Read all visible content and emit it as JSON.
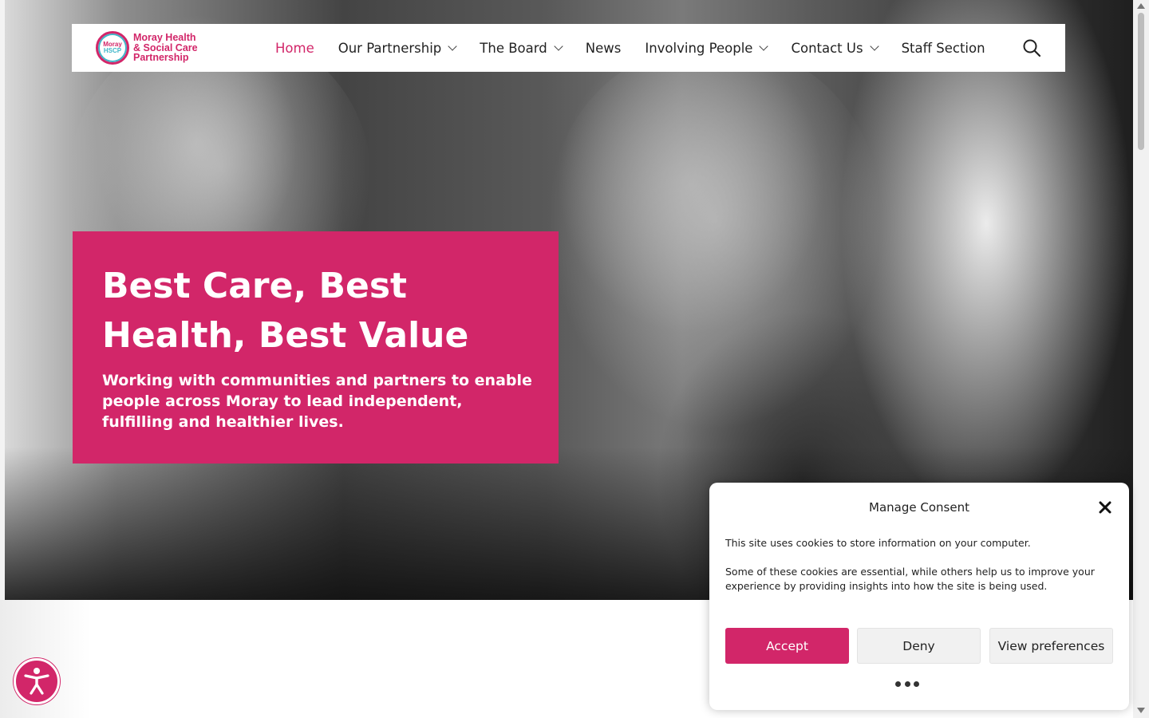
{
  "brand": {
    "logo_circle_line1": "Moray",
    "logo_circle_line2": "HSCP",
    "logo_text": "Moray Health\n& Social Care\nPartnership",
    "accent_color": "#d22669",
    "secondary_color": "#3fb6c9"
  },
  "nav": {
    "items": [
      {
        "label": "Home",
        "active": true,
        "has_dropdown": false
      },
      {
        "label": "Our Partnership",
        "active": false,
        "has_dropdown": true
      },
      {
        "label": "The Board",
        "active": false,
        "has_dropdown": true
      },
      {
        "label": "News",
        "active": false,
        "has_dropdown": false
      },
      {
        "label": "Involving People",
        "active": false,
        "has_dropdown": true
      },
      {
        "label": "Contact Us",
        "active": false,
        "has_dropdown": true
      },
      {
        "label": "Staff Section",
        "active": false,
        "has_dropdown": false
      }
    ],
    "search_icon": "search-icon"
  },
  "hero": {
    "title": "Best Care, Best Health, Best Value",
    "subtitle": "Working with communities and partners to enable people across Moray to lead independent, fulfilling and healthier lives."
  },
  "consent": {
    "title": "Manage Consent",
    "paragraph1": "This site uses cookies to store information on your computer.",
    "paragraph2": "Some of these cookies are essential, while others help us to improve your experience by providing insights into how the site is being used.",
    "accept_label": "Accept",
    "deny_label": "Deny",
    "preferences_label": "View preferences",
    "close_icon": "close-icon",
    "more_icon": "more-dots-icon"
  },
  "accessibility": {
    "icon": "accessibility-icon"
  }
}
